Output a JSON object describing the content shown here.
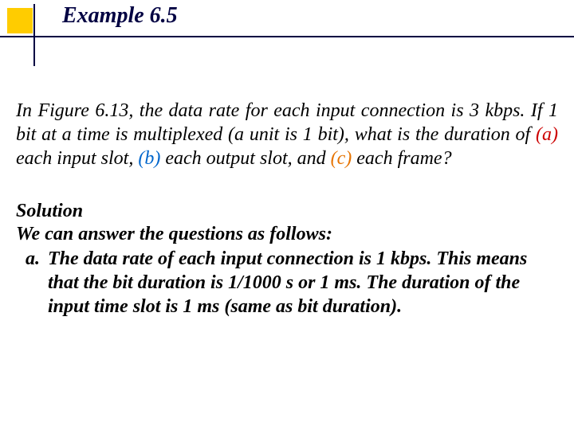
{
  "title": "Example 6.5",
  "question": {
    "pre": "In Figure 6.13, the data rate for each input connection is 3 kbps. If 1 bit at a time is multiplexed (a unit is 1 bit), what is the duration of ",
    "a_label": "(a)",
    "a_text": " each input slot, ",
    "b_label": "(b)",
    "b_text": " each output slot, and ",
    "c_label": "(c)",
    "c_text": " each frame?"
  },
  "solution": {
    "heading": "Solution",
    "intro": "We can answer the questions as follows:",
    "item_a_letter": "a.",
    "item_a_text": "The data rate of each input connection is 1 kbps. This means that the bit duration is 1/1000 s or 1 ms. The duration of the input time slot is 1 ms (same as bit duration)."
  }
}
